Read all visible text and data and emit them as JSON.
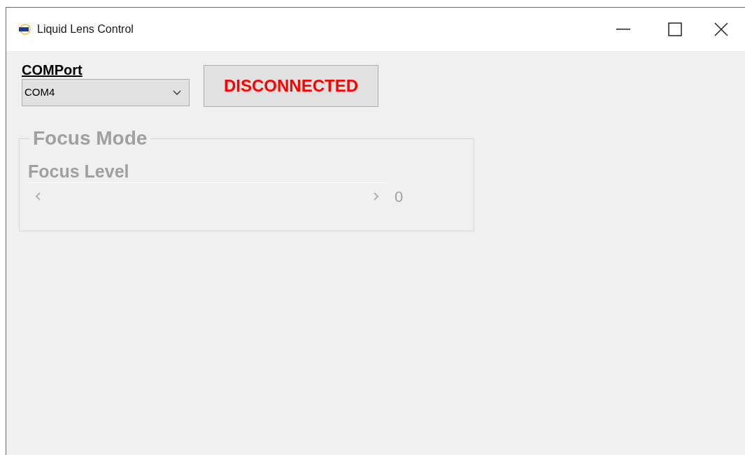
{
  "window": {
    "title": "Liquid Lens Control"
  },
  "com_port": {
    "label": "COMPort",
    "value": "COM4"
  },
  "connection_button": {
    "label": "DISCONNECTED",
    "connected": false
  },
  "focus_mode": {
    "title": "Focus Mode",
    "disabled": true,
    "focus_level": {
      "label": "Focus Level",
      "reading": "0"
    }
  }
}
